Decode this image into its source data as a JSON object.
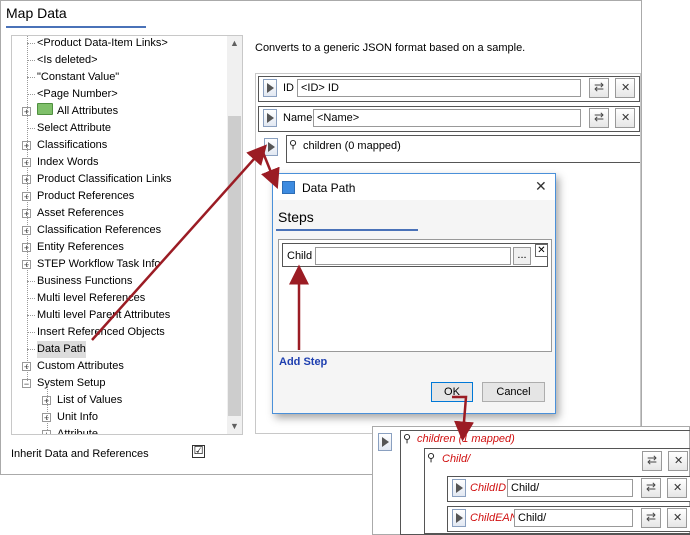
{
  "window": {
    "title": "Map Data"
  },
  "tree": {
    "items": [
      {
        "label": "<Product Data-Item Links>",
        "expander": false
      },
      {
        "label": "<Is deleted>",
        "expander": false
      },
      {
        "label": "\"Constant Value\"",
        "expander": false
      },
      {
        "label": "<Page Number>",
        "expander": false
      },
      {
        "label": "All Attributes",
        "expander": true,
        "icon": "folder-icon"
      },
      {
        "label": "Select Attribute",
        "expander": false
      },
      {
        "label": "Classifications",
        "expander": true
      },
      {
        "label": "Index Words",
        "expander": true
      },
      {
        "label": "Product Classification Links",
        "expander": true
      },
      {
        "label": "Product References",
        "expander": true
      },
      {
        "label": "Asset References",
        "expander": true
      },
      {
        "label": "Classification References",
        "expander": true
      },
      {
        "label": "Entity References",
        "expander": true
      },
      {
        "label": "STEP Workflow Task Info",
        "expander": true
      },
      {
        "label": "Business Functions",
        "expander": false
      },
      {
        "label": "Multi level References",
        "expander": false
      },
      {
        "label": "Multi level Parent Attributes",
        "expander": false
      },
      {
        "label": "Insert Referenced Objects",
        "expander": false
      },
      {
        "label": "Data Path",
        "expander": false,
        "selected": true
      },
      {
        "label": "Custom Attributes",
        "expander": true
      },
      {
        "label": "System Setup",
        "expander": true,
        "expanded": true
      },
      {
        "label": "List of Values",
        "expander": true,
        "child": true
      },
      {
        "label": "Unit Info",
        "expander": true,
        "child": true
      },
      {
        "label": "Attribute",
        "expander": true,
        "child": true
      }
    ]
  },
  "inherit": {
    "label": "Inherit Data and References",
    "checked": true,
    "check_glyph": "☑"
  },
  "mapping": {
    "description": "Converts to a generic JSON format based on a sample.",
    "rows": [
      {
        "label": "ID",
        "value": "<ID> ID"
      },
      {
        "label": "Name",
        "value": "<Name>"
      }
    ],
    "children_label": "children (0 mapped)"
  },
  "dialog": {
    "title": "Data Path",
    "close_glyph": "✕",
    "steps_title": "Steps",
    "child_label": "Child",
    "child_value": "",
    "browse_label": "...",
    "add_step": "Add Step",
    "ok": "OK",
    "cancel": "Cancel"
  },
  "result": {
    "children_label": "children (1 mapped)",
    "child_label": "Child/",
    "rows": [
      {
        "label": "ChildID",
        "value": "Child/"
      },
      {
        "label": "ChildEAN",
        "value": "Child/"
      }
    ]
  },
  "colors": {
    "accent": "#4a72b8",
    "arrow": "#9b1c24",
    "mapped_text": "#d01010",
    "link": "#1e3fb0"
  }
}
